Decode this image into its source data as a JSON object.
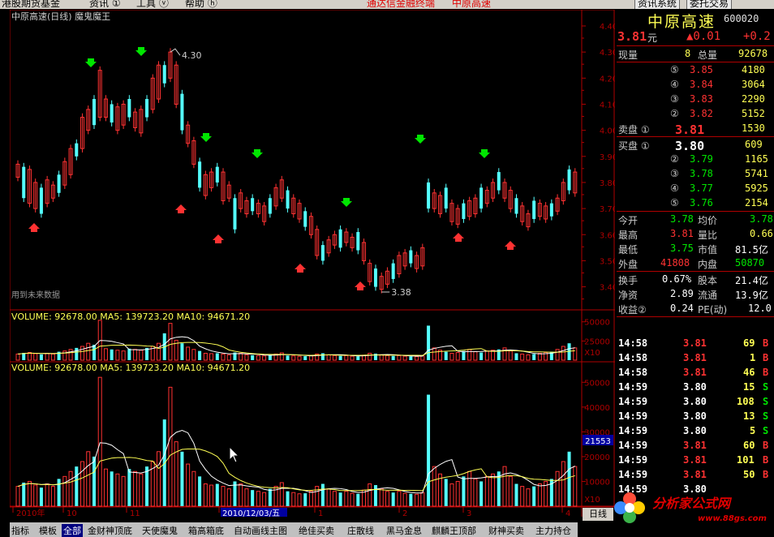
{
  "menubar": {
    "items": [
      "港股期货基金",
      "资讯 ①",
      "工具 ⓥ",
      "帮助 ⓗ"
    ],
    "center": "通达信金融终端",
    "stock": "中原高速",
    "btn1": "资讯系统",
    "btn2": "委托交易"
  },
  "chart": {
    "title": "中原高速(日线) 魔鬼魔王",
    "note": "用到未来数据",
    "high_label": "4.30",
    "low_label": "3.38",
    "price_ticks": [
      "4.40",
      "4.30",
      "4.20",
      "4.10",
      "4.00",
      "3.90",
      "3.80",
      "3.70",
      "3.60",
      "3.50",
      "3.40"
    ],
    "vol1_title": "VOLUME: 92678.00  MA5: 139723.20  MA10: 94671.20",
    "vol1_ticks": [
      "50000",
      "25000"
    ],
    "vol1_x10": "X10",
    "vol2_title": "VOLUME: 92678.00  MA5: 139723.20  MA10: 94671.20",
    "vol2_ticks": [
      "50000",
      "40000",
      "30000",
      "20000",
      "10000"
    ],
    "vol2_cursor": "21553",
    "vol2_x10": "X10",
    "date_axis": [
      "2010年",
      "10",
      "11",
      "2010/12/03/五",
      "1",
      "2",
      "3",
      "4"
    ],
    "period_button": "日线"
  },
  "chart_data": {
    "type": "candlestick",
    "title": "中原高速(日线) 魔鬼魔王",
    "ylim": [
      3.38,
      4.4
    ],
    "candles": [
      [
        3.82,
        3.87
      ],
      [
        3.74,
        3.86
      ],
      [
        3.72,
        3.85
      ],
      [
        3.7,
        3.8
      ],
      [
        3.68,
        3.78
      ],
      [
        3.72,
        3.81
      ],
      [
        3.74,
        3.79
      ],
      [
        3.76,
        3.83
      ],
      [
        3.79,
        3.88
      ],
      [
        3.83,
        3.93
      ],
      [
        3.9,
        3.95
      ],
      [
        3.93,
        4.05
      ],
      [
        4.0,
        4.08
      ],
      [
        4.02,
        4.12
      ],
      [
        4.05,
        4.23
      ],
      [
        4.05,
        4.12
      ],
      [
        4.03,
        4.1
      ],
      [
        4.0,
        4.09
      ],
      [
        4.02,
        4.1
      ],
      [
        4.05,
        4.12
      ],
      [
        4.01,
        4.07
      ],
      [
        3.99,
        4.08
      ],
      [
        4.05,
        4.12
      ],
      [
        4.08,
        4.2
      ],
      [
        4.12,
        4.25
      ],
      [
        4.18,
        4.25
      ],
      [
        4.2,
        4.3
      ],
      [
        4.1,
        4.25
      ],
      [
        4.0,
        4.14
      ],
      [
        3.95,
        4.02
      ],
      [
        3.87,
        3.96
      ],
      [
        3.78,
        3.88
      ],
      [
        3.75,
        3.83
      ],
      [
        3.78,
        3.84
      ],
      [
        3.8,
        3.86
      ],
      [
        3.73,
        3.84
      ],
      [
        3.74,
        3.79
      ],
      [
        3.62,
        3.74
      ],
      [
        3.7,
        3.76
      ],
      [
        3.68,
        3.73
      ],
      [
        3.69,
        3.74
      ],
      [
        3.68,
        3.72
      ],
      [
        3.65,
        3.71
      ],
      [
        3.68,
        3.74
      ],
      [
        3.71,
        3.78
      ],
      [
        3.74,
        3.81
      ],
      [
        3.7,
        3.77
      ],
      [
        3.68,
        3.74
      ],
      [
        3.66,
        3.72
      ],
      [
        3.63,
        3.69
      ],
      [
        3.6,
        3.67
      ],
      [
        3.52,
        3.62
      ],
      [
        3.5,
        3.56
      ],
      [
        3.53,
        3.58
      ],
      [
        3.56,
        3.6
      ],
      [
        3.55,
        3.62
      ],
      [
        3.57,
        3.61
      ],
      [
        3.55,
        3.59
      ],
      [
        3.54,
        3.61
      ],
      [
        3.5,
        3.57
      ],
      [
        3.42,
        3.49
      ],
      [
        3.4,
        3.47
      ],
      [
        3.39,
        3.44
      ],
      [
        3.41,
        3.46
      ],
      [
        3.43,
        3.49
      ],
      [
        3.45,
        3.52
      ],
      [
        3.48,
        3.53
      ],
      [
        3.49,
        3.54
      ],
      [
        3.47,
        3.52
      ],
      [
        3.48,
        3.55
      ],
      [
        3.7,
        3.8
      ],
      [
        3.7,
        3.76
      ],
      [
        3.68,
        3.75
      ],
      [
        3.7,
        3.78
      ],
      [
        3.65,
        3.72
      ],
      [
        3.64,
        3.7
      ],
      [
        3.66,
        3.72
      ],
      [
        3.67,
        3.73
      ],
      [
        3.68,
        3.74
      ],
      [
        3.7,
        3.78
      ],
      [
        3.72,
        3.77
      ],
      [
        3.74,
        3.8
      ],
      [
        3.77,
        3.84
      ],
      [
        3.74,
        3.8
      ],
      [
        3.7,
        3.77
      ],
      [
        3.68,
        3.74
      ],
      [
        3.65,
        3.71
      ],
      [
        3.63,
        3.68
      ],
      [
        3.66,
        3.73
      ],
      [
        3.67,
        3.72
      ],
      [
        3.66,
        3.71
      ],
      [
        3.67,
        3.72
      ],
      [
        3.69,
        3.74
      ],
      [
        3.73,
        3.8
      ],
      [
        3.77,
        3.85
      ],
      [
        3.76,
        3.84
      ]
    ],
    "volume_upper_ylim": [
      0,
      55000
    ],
    "volume_lower_ylim": [
      0,
      55000
    ],
    "volumes": [
      8000,
      9500,
      10000,
      8500,
      7500,
      9000,
      8000,
      11000,
      12000,
      14000,
      16000,
      18000,
      22000,
      20000,
      52000,
      15000,
      14000,
      13000,
      12000,
      15000,
      14000,
      13000,
      16000,
      18000,
      22000,
      35000,
      48000,
      26000,
      22000,
      17000,
      14000,
      12000,
      9000,
      8500,
      9000,
      8000,
      7000,
      10000,
      9000,
      7000,
      6500,
      6000,
      5500,
      7000,
      8000,
      9500,
      6000,
      5500,
      5000,
      5200,
      6000,
      8000,
      9000,
      7000,
      6000,
      5500,
      6000,
      5200,
      5000,
      6500,
      9000,
      8500,
      7000,
      6000,
      5500,
      6000,
      5200,
      5000,
      4800,
      5500,
      45000,
      16000,
      13000,
      11000,
      9000,
      10000,
      12000,
      14000,
      11000,
      10000,
      12000,
      13000,
      14000,
      16000,
      12000,
      9000,
      8000,
      7000,
      8000,
      9000,
      10000,
      11000,
      14000,
      18000,
      22000,
      16000
    ]
  },
  "rpanel": {
    "name": "中原高速",
    "code": "600020",
    "price": "3.81",
    "unit": "元",
    "change": "▲0.01",
    "pct": "+0.2",
    "xianliang_label": "现量",
    "xianliang": "8",
    "zongliang_label": "总量",
    "zongliang": "92678",
    "sell": [
      {
        "lvl": "⑤",
        "p": "3.85",
        "v": "4180"
      },
      {
        "lvl": "④",
        "p": "3.84",
        "v": "3064"
      },
      {
        "lvl": "③",
        "p": "3.83",
        "v": "2290"
      },
      {
        "lvl": "②",
        "p": "3.82",
        "v": "5152"
      },
      {
        "lvl": "卖盘 ①",
        "p": "3.81",
        "v": "1530"
      }
    ],
    "buy": [
      {
        "lvl": "买盘 ①",
        "p": "3.80",
        "v": "609"
      },
      {
        "lvl": "②",
        "p": "3.79",
        "v": "1165"
      },
      {
        "lvl": "③",
        "p": "3.78",
        "v": "5741"
      },
      {
        "lvl": "④",
        "p": "3.77",
        "v": "5925"
      },
      {
        "lvl": "⑤",
        "p": "3.76",
        "v": "2154"
      }
    ],
    "stats": [
      {
        "l1": "今开",
        "v1": "3.78",
        "l2": "均价",
        "v2": "3.78"
      },
      {
        "l1": "最高",
        "v1": "3.81",
        "l2": "量比",
        "v2": "0.66"
      },
      {
        "l1": "最低",
        "v1": "3.75",
        "l2": "市值",
        "v2": "81.5亿"
      },
      {
        "l1": "外盘",
        "v1": "41808",
        "l2": "内盘",
        "v2": "50870"
      }
    ],
    "stats2": [
      {
        "l1": "换手",
        "v1": "0.67%",
        "l2": "股本",
        "v2": "21.4亿"
      },
      {
        "l1": "净资",
        "v1": "2.89",
        "l2": "流通",
        "v2": "13.9亿"
      },
      {
        "l1": "收益②",
        "v1": "0.24",
        "l2": "PE(动)",
        "v2": "12.0"
      }
    ],
    "ticks": [
      {
        "t": "14:58",
        "p": "3.81",
        "v": "69",
        "s": "B",
        "c": "red"
      },
      {
        "t": "14:58",
        "p": "3.81",
        "v": "1",
        "s": "B",
        "c": "red"
      },
      {
        "t": "14:58",
        "p": "3.81",
        "v": "46",
        "s": "B",
        "c": "red"
      },
      {
        "t": "14:59",
        "p": "3.80",
        "v": "15",
        "s": "S",
        "c": "white"
      },
      {
        "t": "14:59",
        "p": "3.80",
        "v": "108",
        "s": "S",
        "c": "white"
      },
      {
        "t": "14:59",
        "p": "3.80",
        "v": "13",
        "s": "S",
        "c": "white"
      },
      {
        "t": "14:59",
        "p": "3.80",
        "v": "5",
        "s": "S",
        "c": "white"
      },
      {
        "t": "14:59",
        "p": "3.81",
        "v": "60",
        "s": "B",
        "c": "red"
      },
      {
        "t": "14:59",
        "p": "3.81",
        "v": "101",
        "s": "B",
        "c": "red"
      },
      {
        "t": "14:59",
        "p": "3.81",
        "v": "50",
        "s": "B",
        "c": "red"
      },
      {
        "t": "14:59",
        "p": "3.80",
        "v": "",
        "s": "",
        "c": "white"
      }
    ]
  },
  "bottombar": {
    "tabs": [
      "指标",
      "模板",
      "全部",
      "金财神顶底",
      "天使魔鬼",
      "箱高箱底",
      "自动画线主图",
      "绝佳买卖",
      "庄散线",
      "黑马金息",
      "麒麟王顶部",
      "财神买卖",
      "主力持仓"
    ]
  },
  "watermark": {
    "text": "分析家公式网",
    "url": "www.88gs.com"
  },
  "colors": {
    "up": "#ff3232",
    "down": "#54ffff",
    "axis": "#b00000",
    "yellow": "#ffff54",
    "green": "#00e600"
  }
}
